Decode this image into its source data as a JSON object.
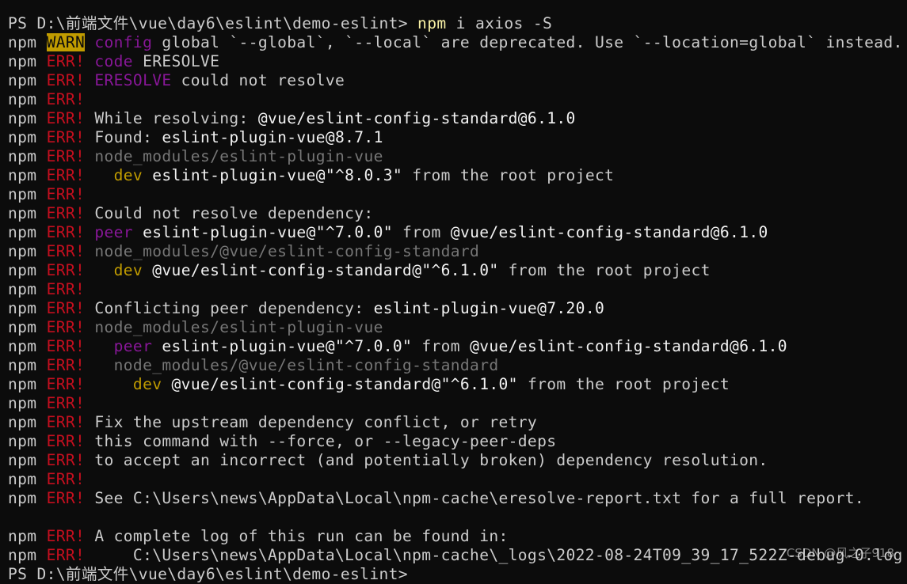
{
  "colors": {
    "background": "#0c0c0c",
    "default": "#cccccc",
    "bright": "#f2f2f2",
    "error": "#c50f1f",
    "keyword": "#881798",
    "dev": "#c19c00",
    "command": "#f9f1a5",
    "path": "#767676"
  },
  "watermark": "CSDN @风之子918",
  "lines": [
    [
      [
        "PS D:\\前端文件\\vue\\day6\\eslint\\demo-eslint> ",
        "d"
      ],
      [
        "npm",
        "by"
      ],
      [
        " i axios -S",
        "d"
      ]
    ],
    [
      [
        "npm ",
        "d"
      ],
      [
        "WARN",
        "warn"
      ],
      [
        " ",
        "d"
      ],
      [
        "config",
        "p"
      ],
      [
        " global `--global`, `--local` are deprecated. Use `--location=global` instead.",
        "d"
      ]
    ],
    [
      [
        "npm ",
        "d"
      ],
      [
        "ERR!",
        "r"
      ],
      [
        " ",
        "d"
      ],
      [
        "code",
        "p"
      ],
      [
        " ERESOLVE",
        "d"
      ]
    ],
    [
      [
        "npm ",
        "d"
      ],
      [
        "ERR!",
        "r"
      ],
      [
        " ",
        "d"
      ],
      [
        "ERESOLVE",
        "p"
      ],
      [
        " could not resolve",
        "d"
      ]
    ],
    [
      [
        "npm ",
        "d"
      ],
      [
        "ERR!",
        "r"
      ]
    ],
    [
      [
        "npm ",
        "d"
      ],
      [
        "ERR!",
        "r"
      ],
      [
        " While resolving: ",
        "d"
      ],
      [
        "@vue/eslint-config-standard@6.1.0",
        "w"
      ]
    ],
    [
      [
        "npm ",
        "d"
      ],
      [
        "ERR!",
        "r"
      ],
      [
        " Found: ",
        "d"
      ],
      [
        "eslint-plugin-vue@8.7.1",
        "w"
      ]
    ],
    [
      [
        "npm ",
        "d"
      ],
      [
        "ERR!",
        "r"
      ],
      [
        " ",
        "d"
      ],
      [
        "node_modules/eslint-plugin-vue",
        "g"
      ]
    ],
    [
      [
        "npm ",
        "d"
      ],
      [
        "ERR!",
        "r"
      ],
      [
        "   ",
        "d"
      ],
      [
        "dev",
        "y"
      ],
      [
        " ",
        "d"
      ],
      [
        "eslint-plugin-vue@\"^8.0.3\"",
        "w"
      ],
      [
        " from the root project",
        "d"
      ]
    ],
    [
      [
        "npm ",
        "d"
      ],
      [
        "ERR!",
        "r"
      ]
    ],
    [
      [
        "npm ",
        "d"
      ],
      [
        "ERR!",
        "r"
      ],
      [
        " Could not resolve dependency:",
        "d"
      ]
    ],
    [
      [
        "npm ",
        "d"
      ],
      [
        "ERR!",
        "r"
      ],
      [
        " ",
        "d"
      ],
      [
        "peer",
        "p"
      ],
      [
        " ",
        "d"
      ],
      [
        "eslint-plugin-vue@\"^7.0.0\"",
        "w"
      ],
      [
        " from ",
        "d"
      ],
      [
        "@vue/eslint-config-standard@6.1.0",
        "w"
      ]
    ],
    [
      [
        "npm ",
        "d"
      ],
      [
        "ERR!",
        "r"
      ],
      [
        " ",
        "d"
      ],
      [
        "node_modules/@vue/eslint-config-standard",
        "g"
      ]
    ],
    [
      [
        "npm ",
        "d"
      ],
      [
        "ERR!",
        "r"
      ],
      [
        "   ",
        "d"
      ],
      [
        "dev",
        "y"
      ],
      [
        " ",
        "d"
      ],
      [
        "@vue/eslint-config-standard@\"^6.1.0\"",
        "w"
      ],
      [
        " from the root project",
        "d"
      ]
    ],
    [
      [
        "npm ",
        "d"
      ],
      [
        "ERR!",
        "r"
      ]
    ],
    [
      [
        "npm ",
        "d"
      ],
      [
        "ERR!",
        "r"
      ],
      [
        " Conflicting peer dependency: ",
        "d"
      ],
      [
        "eslint-plugin-vue@7.20.0",
        "w"
      ]
    ],
    [
      [
        "npm ",
        "d"
      ],
      [
        "ERR!",
        "r"
      ],
      [
        " ",
        "d"
      ],
      [
        "node_modules/eslint-plugin-vue",
        "g"
      ]
    ],
    [
      [
        "npm ",
        "d"
      ],
      [
        "ERR!",
        "r"
      ],
      [
        "   ",
        "d"
      ],
      [
        "peer",
        "p"
      ],
      [
        " ",
        "d"
      ],
      [
        "eslint-plugin-vue@\"^7.0.0\"",
        "w"
      ],
      [
        " from ",
        "d"
      ],
      [
        "@vue/eslint-config-standard@6.1.0",
        "w"
      ]
    ],
    [
      [
        "npm ",
        "d"
      ],
      [
        "ERR!",
        "r"
      ],
      [
        "   ",
        "d"
      ],
      [
        "node_modules/@vue/eslint-config-standard",
        "g"
      ]
    ],
    [
      [
        "npm ",
        "d"
      ],
      [
        "ERR!",
        "r"
      ],
      [
        "     ",
        "d"
      ],
      [
        "dev",
        "y"
      ],
      [
        " ",
        "d"
      ],
      [
        "@vue/eslint-config-standard@\"^6.1.0\"",
        "w"
      ],
      [
        " from the root project",
        "d"
      ]
    ],
    [
      [
        "npm ",
        "d"
      ],
      [
        "ERR!",
        "r"
      ]
    ],
    [
      [
        "npm ",
        "d"
      ],
      [
        "ERR!",
        "r"
      ],
      [
        " Fix the upstream dependency conflict, or retry",
        "d"
      ]
    ],
    [
      [
        "npm ",
        "d"
      ],
      [
        "ERR!",
        "r"
      ],
      [
        " this command with --force, or --legacy-peer-deps",
        "d"
      ]
    ],
    [
      [
        "npm ",
        "d"
      ],
      [
        "ERR!",
        "r"
      ],
      [
        " to accept an incorrect (and potentially broken) dependency resolution.",
        "d"
      ]
    ],
    [
      [
        "npm ",
        "d"
      ],
      [
        "ERR!",
        "r"
      ]
    ],
    [
      [
        "npm ",
        "d"
      ],
      [
        "ERR!",
        "r"
      ],
      [
        " See C:\\Users\\news\\AppData\\Local\\npm-cache\\eresolve-report.txt for a full report.",
        "d"
      ]
    ],
    [],
    [
      [
        "npm ",
        "d"
      ],
      [
        "ERR!",
        "r"
      ],
      [
        " A complete log of this run can be found in:",
        "d"
      ]
    ],
    [
      [
        "npm ",
        "d"
      ],
      [
        "ERR!",
        "r"
      ],
      [
        "     C:\\Users\\news\\AppData\\Local\\npm-cache\\_logs\\2022-08-24T09_39_17_522Z-debug-0.log",
        "d"
      ]
    ],
    [
      [
        "PS D:\\前端文件\\vue\\day6\\eslint\\demo-eslint>",
        "d"
      ]
    ]
  ]
}
